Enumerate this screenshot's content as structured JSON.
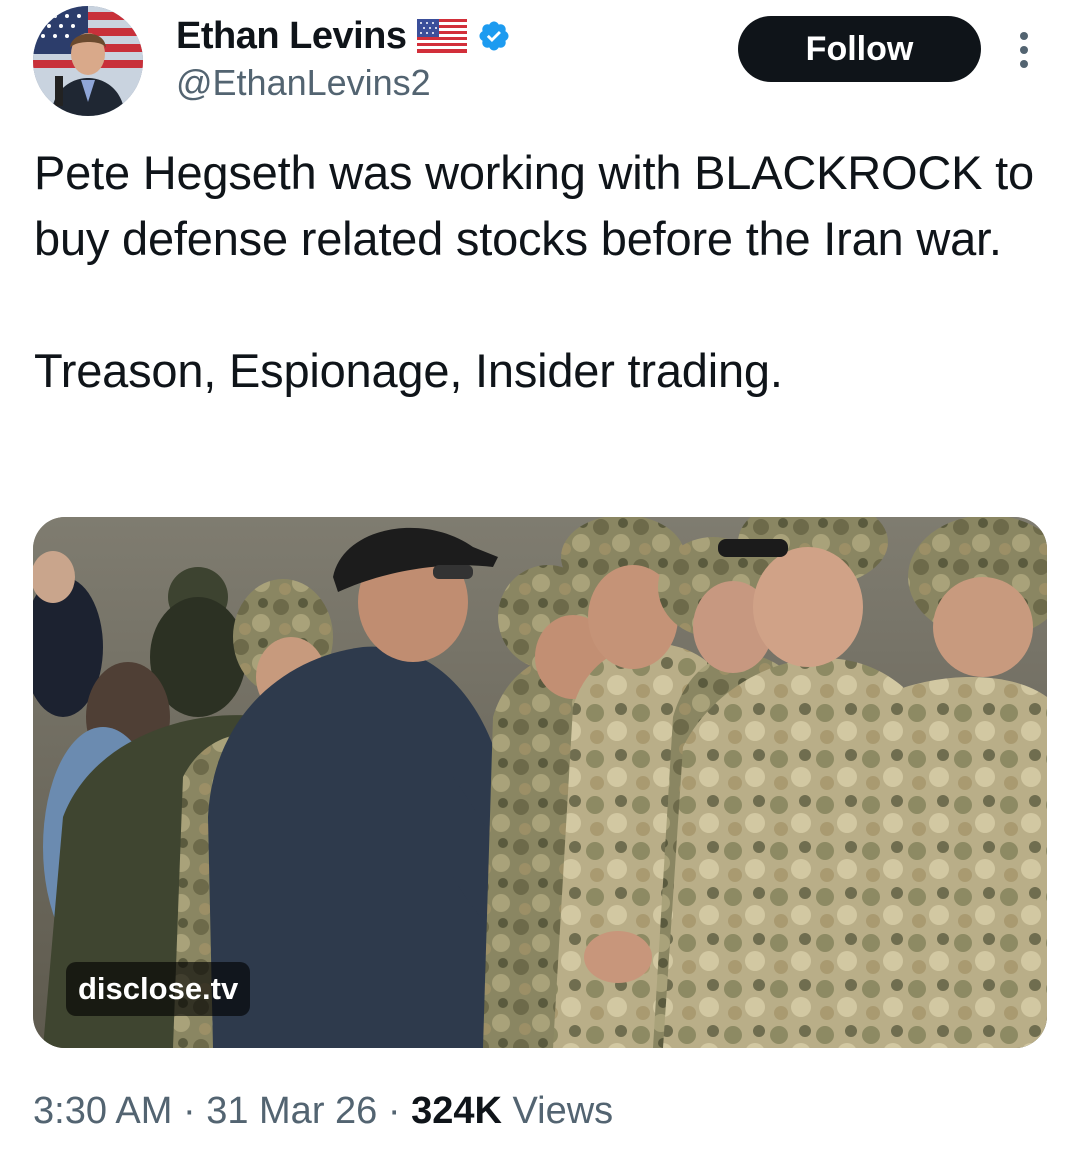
{
  "author": {
    "name": "Ethan Levins",
    "handle": "@EthanLevins2",
    "flag_icon": "us-flag-icon",
    "verified_icon": "verified-badge-icon",
    "verified_color": "#1d9bf0"
  },
  "actions": {
    "follow_label": "Follow",
    "more_icon": "more-vertical-icon"
  },
  "tweet": {
    "paragraphs": [
      "Pete Hegseth was working with BLACKROCK to buy defense related stocks before the Iran war.",
      "Treason, Espionage, Insider trading."
    ]
  },
  "media": {
    "source_label": "disclose.tv"
  },
  "meta": {
    "time": "3:30 AM",
    "separator": "·",
    "date": "31 Mar 26",
    "views_count": "324K",
    "views_label": "Views"
  },
  "colors": {
    "text_primary": "#0f1419",
    "text_secondary": "#536471",
    "button_bg": "#0f1419"
  }
}
